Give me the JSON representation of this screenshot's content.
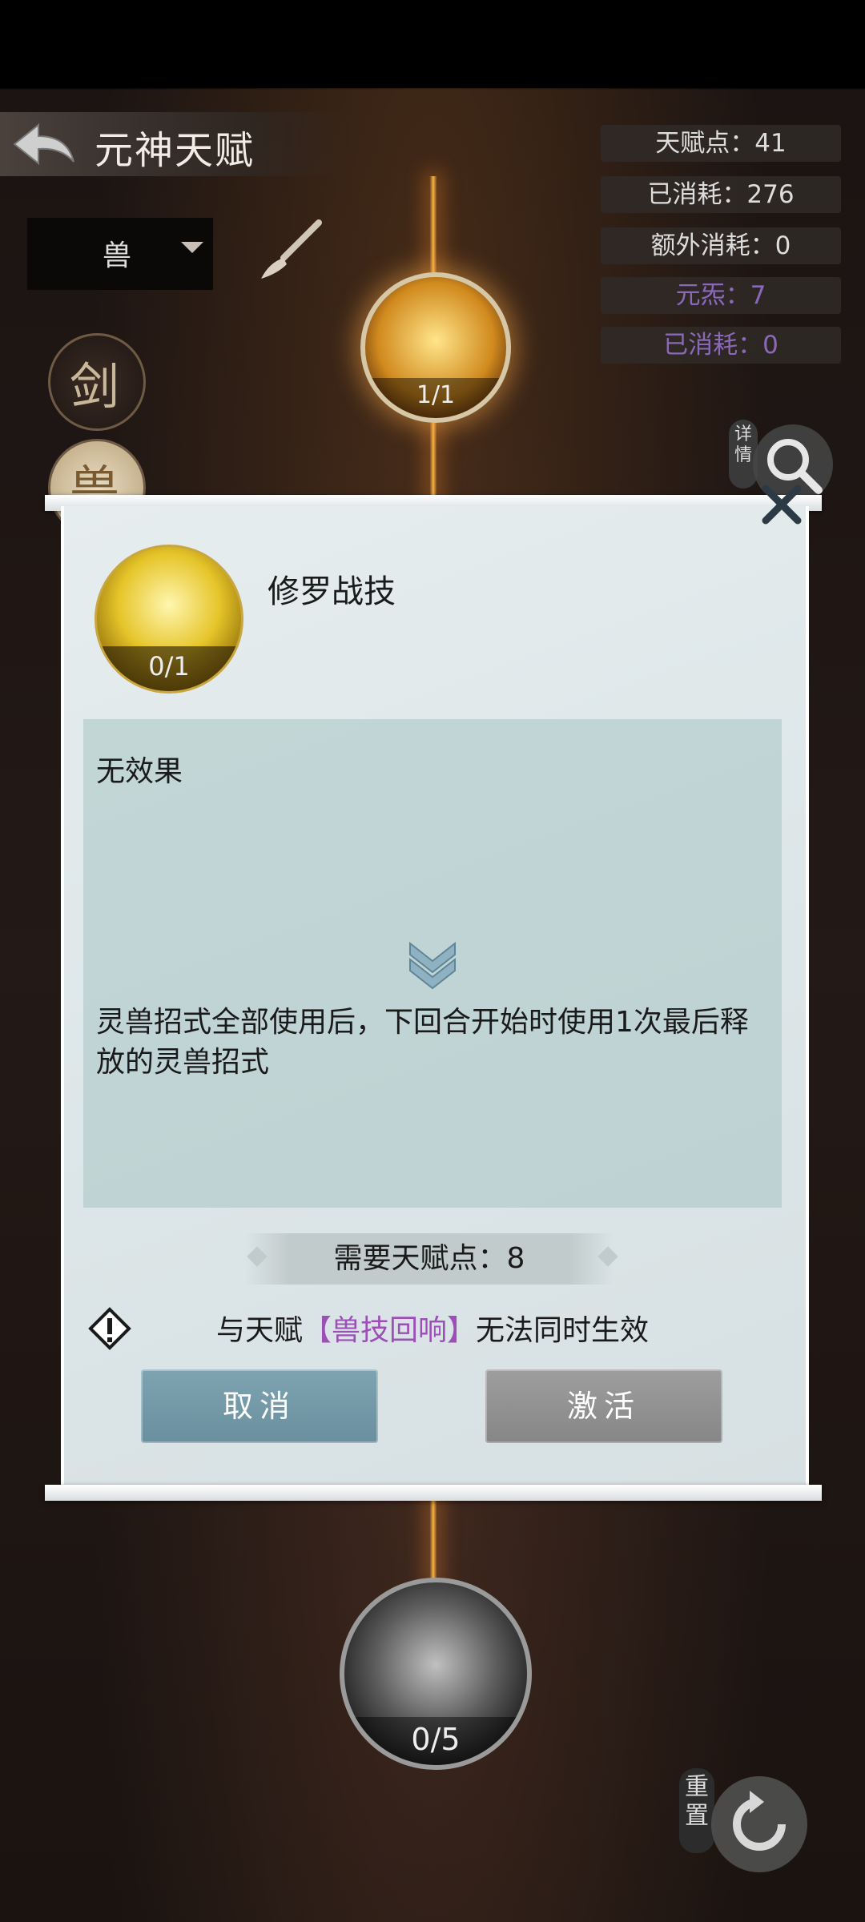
{
  "header": {
    "title": "元神天赋",
    "back_icon": "back-arrow-icon"
  },
  "stats": {
    "talent_points": "天赋点：41",
    "consumed": "已消耗：276",
    "extra_consumed": "额外消耗：0",
    "yuan_xi": "元炁：7",
    "yuan_xi_consumed": "已消耗：0"
  },
  "filter": {
    "selected": "兽"
  },
  "side_categories": [
    "剑",
    "兽"
  ],
  "top_node": {
    "count": "1/1"
  },
  "detail_label": "详情",
  "reset_label": "重置",
  "bottom_node": {
    "count": "0/5"
  },
  "dialog": {
    "skill_name": "修罗战技",
    "skill_count": "0/1",
    "current_effect": "无效果",
    "next_effect": "灵兽招式全部使用后，下回合开始时使用1次最后释放的灵兽招式",
    "cost": "需要天赋点：8",
    "warning_prefix": "与天赋",
    "warning_link": "【兽技回响】",
    "warning_suffix": "无法同时生效",
    "cancel_label": "取消",
    "activate_label": "激活"
  },
  "colors": {
    "accent_purple": "#9c4fb6",
    "cancel_button": "#7ea3b1",
    "activate_button": "#8f8f8f"
  }
}
